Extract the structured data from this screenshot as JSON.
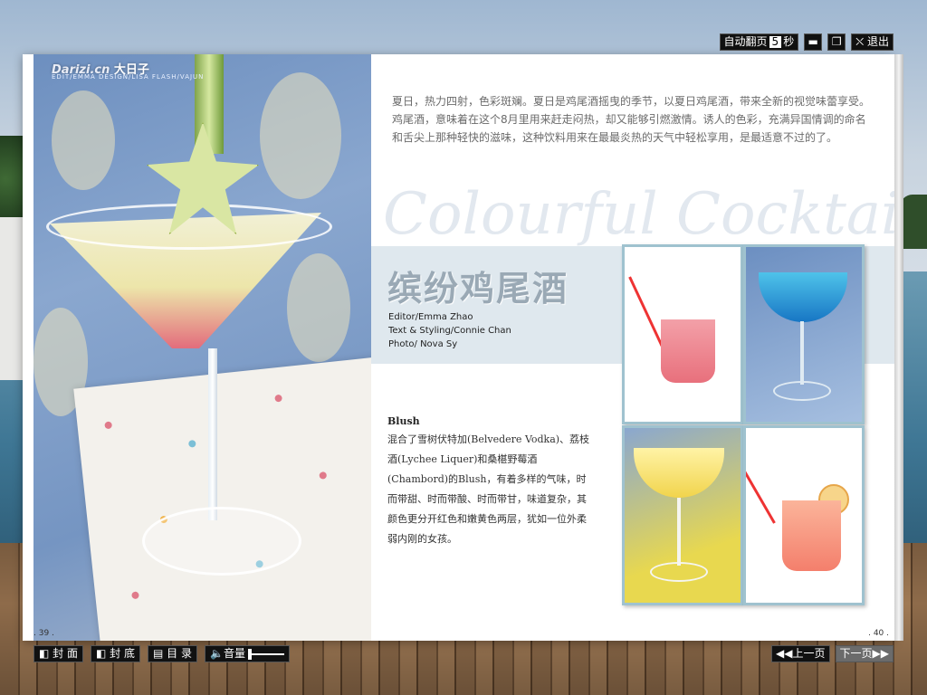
{
  "topbar": {
    "autoflip_label": "自动翻页",
    "autoflip_seconds": "5",
    "seconds_unit": "秒",
    "exit_label": "退出"
  },
  "header": {
    "logo_en": "Darizi.cn",
    "logo_cn": "大日子",
    "credit_line": "EDIT/EMMA   DESIGN/LISA   FLASH/VAJUN"
  },
  "page_numbers": {
    "left": ". 39 .",
    "right": ". 40 ."
  },
  "intro": "夏日，热力四射，色彩斑斓。夏日是鸡尾酒摇曳的季节，以夏日鸡尾酒，带来全新的视觉味蕾享受。鸡尾酒，意味着在这个8月里用来赶走闷热，却又能够引燃激情。诱人的色彩，充满异国情调的命名和舌尖上那种轻快的滋味，这种饮料用来在最最炎热的天气中轻松享用，是最适意不过的了。",
  "deco_title": "Colourful Cocktail",
  "title": "缤纷鸡尾酒",
  "credits": {
    "editor": "Editor/Emma Zhao",
    "text": "Text & Styling/Connie Chan",
    "photo": "Photo/ Nova Sy"
  },
  "article": {
    "heading": "Blush",
    "body": "混合了雪树伏特加(Belvedere Vodka)、荔枝酒(Lychee Liquer)和桑椹野莓酒(Chambord)的Blush，有着多样的气味，时而带甜、时而带酸、时而带甘，味道复杂，其颜色更分开红色和嫩黄色两层，犹如一位外柔弱内刚的女孩。"
  },
  "bottombar": {
    "cover": "封 面",
    "back_cover": "封 底",
    "contents": "目 录",
    "volume": "音量",
    "prev": "上一页",
    "next": "下一页"
  },
  "colors": {
    "accent_band": "#dfe8ee",
    "title_gray": "#9aa9b5",
    "toolbar": "#111111"
  }
}
